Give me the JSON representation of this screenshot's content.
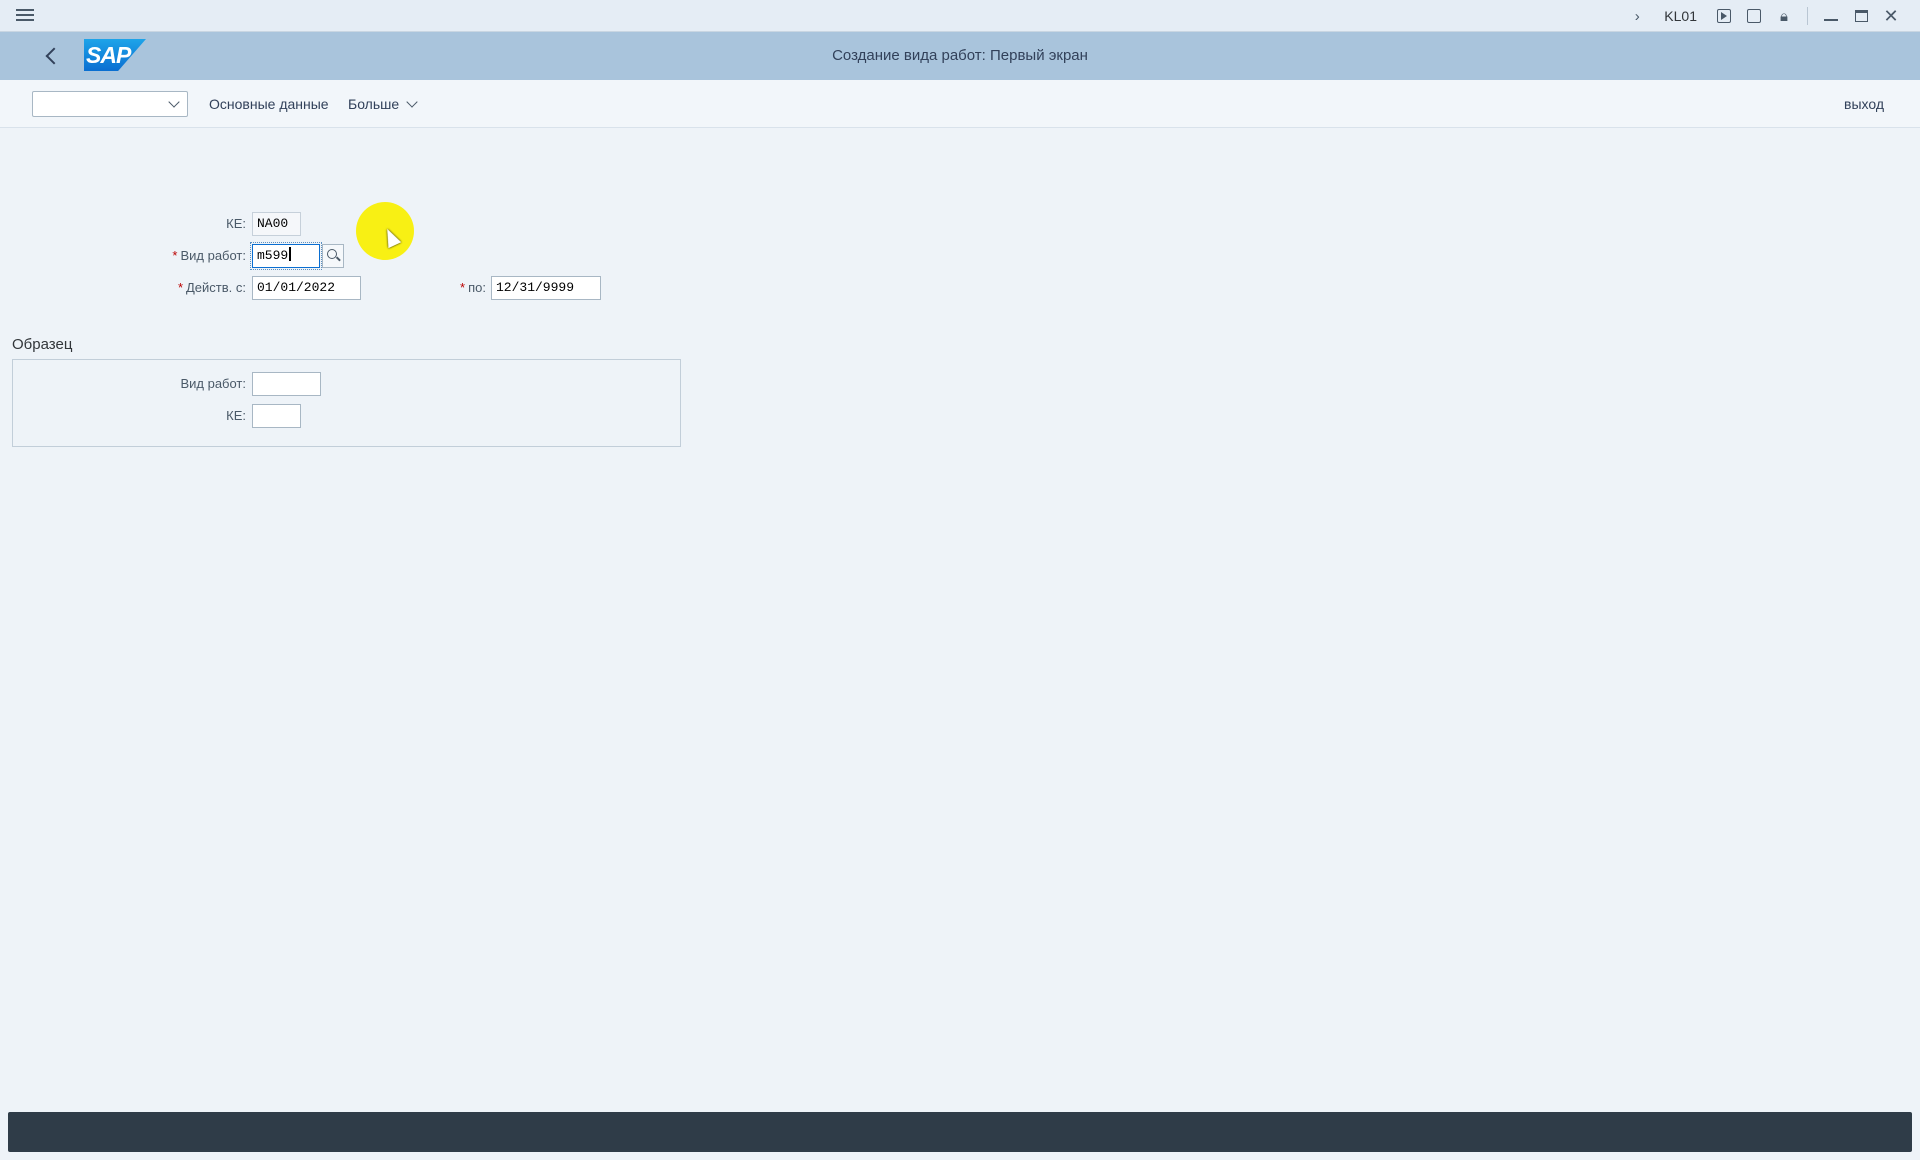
{
  "system_bar": {
    "transaction": "KL01"
  },
  "header": {
    "title": "Создание вида работ: Первый экран"
  },
  "toolbar": {
    "dropdown_value": "",
    "master_data_label": "Основные данные",
    "more_label": "Больше",
    "exit_label": "выход"
  },
  "form": {
    "controlling_area": {
      "label": "КЕ:",
      "value": "NA00"
    },
    "activity_type": {
      "label": "Вид работ:",
      "value": "m599"
    },
    "valid_from": {
      "label": "Действ. с:",
      "value": "01/01/2022"
    },
    "valid_to": {
      "label": "по:",
      "value": "12/31/9999"
    }
  },
  "template": {
    "title": "Образец",
    "activity_type": {
      "label": "Вид работ:",
      "value": ""
    },
    "controlling_area": {
      "label": "КЕ:",
      "value": ""
    }
  },
  "colors": {
    "shell": "#a9c4dc",
    "background": "#eef3f8",
    "required": "#bb0000",
    "status_bar": "#2f3c48"
  }
}
